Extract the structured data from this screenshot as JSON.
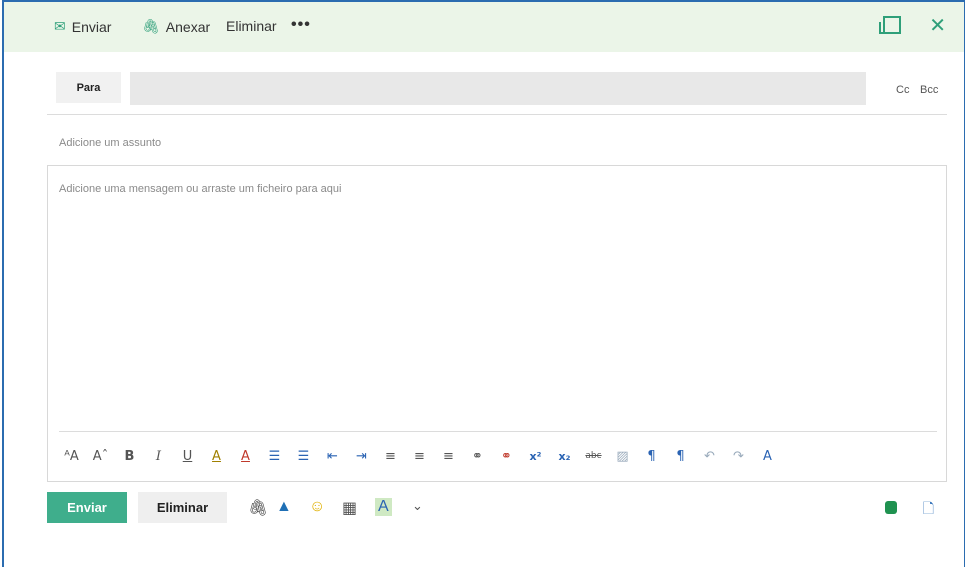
{
  "toolbar": {
    "send_label": "Enviar",
    "attach_label": "Anexar",
    "delete_label": "Eliminar",
    "more_label": "•••"
  },
  "compose": {
    "to_label": "Para",
    "cc_label": "Cc",
    "bcc_label": "Bcc",
    "subject_placeholder": "Adicione um assunto",
    "body_placeholder": "Adicione uma mensagem ou arraste um ficheiro para aqui"
  },
  "formatting": {
    "buttons": [
      {
        "name": "font-size-icon",
        "glyph": "ᴬA"
      },
      {
        "name": "grow-font-icon",
        "glyph": "Aˆ"
      },
      {
        "name": "bold-icon",
        "glyph": "B"
      },
      {
        "name": "italic-icon",
        "glyph": "I"
      },
      {
        "name": "underline-icon",
        "glyph": "U"
      },
      {
        "name": "highlight-icon",
        "glyph": "A"
      },
      {
        "name": "font-color-icon",
        "glyph": "A"
      },
      {
        "name": "bullets-icon",
        "glyph": "☰"
      },
      {
        "name": "numbering-icon",
        "glyph": "☰"
      },
      {
        "name": "outdent-icon",
        "glyph": "⇤"
      },
      {
        "name": "indent-icon",
        "glyph": "⇥"
      },
      {
        "name": "align-left-icon",
        "glyph": "≡"
      },
      {
        "name": "align-center-icon",
        "glyph": "≡"
      },
      {
        "name": "align-right-icon",
        "glyph": "≡"
      },
      {
        "name": "link-icon",
        "glyph": "⚭"
      },
      {
        "name": "unlink-icon",
        "glyph": "⚭"
      },
      {
        "name": "superscript-icon",
        "glyph": "x²"
      },
      {
        "name": "subscript-icon",
        "glyph": "x₂"
      },
      {
        "name": "strikethrough-icon",
        "glyph": "abc"
      },
      {
        "name": "inline-image-icon",
        "glyph": "▨"
      },
      {
        "name": "ltr-icon",
        "glyph": "¶"
      },
      {
        "name": "rtl-icon",
        "glyph": "¶"
      },
      {
        "name": "undo-icon",
        "glyph": "↶"
      },
      {
        "name": "redo-icon",
        "glyph": "↷"
      },
      {
        "name": "clear-format-icon",
        "glyph": "A"
      }
    ]
  },
  "actions": {
    "send_label": "Enviar",
    "delete_label": "Eliminar"
  },
  "colors": {
    "accent": "#3fae8c",
    "topbar_bg": "#ebf5e8",
    "frame": "#2b6cb0"
  }
}
